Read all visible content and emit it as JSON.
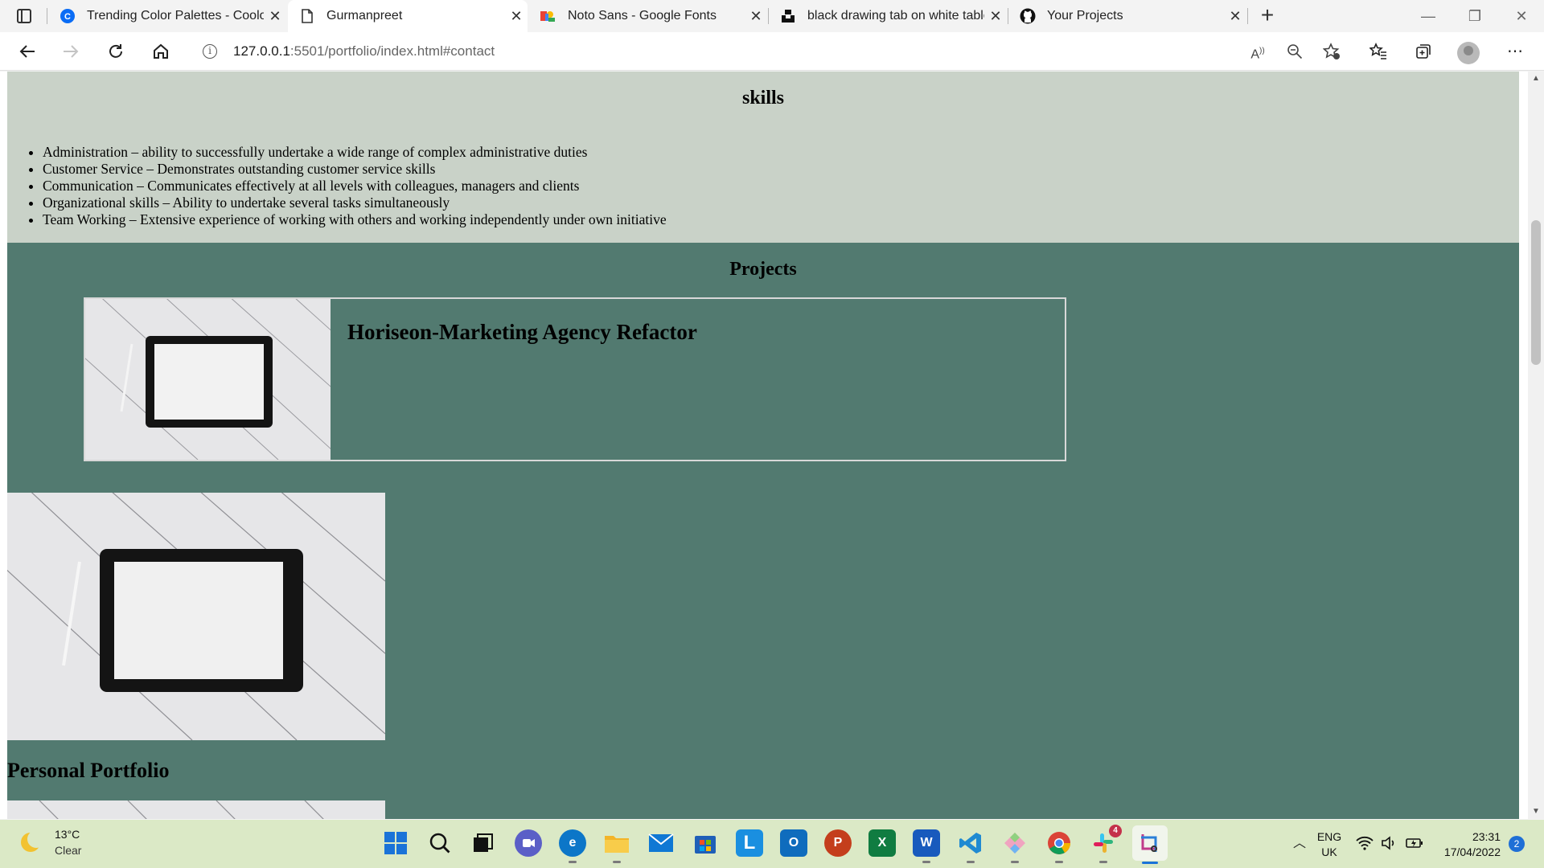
{
  "browser": {
    "tabs": [
      {
        "title": "Trending Color Palettes - Coolors",
        "icon": "coolors-icon",
        "active": false
      },
      {
        "title": "Gurmanpreet",
        "icon": "page-icon",
        "active": true
      },
      {
        "title": "Noto Sans - Google Fonts",
        "icon": "google-fonts-icon",
        "active": false
      },
      {
        "title": "black drawing tab on white table",
        "icon": "unsplash-icon",
        "active": false
      },
      {
        "title": "Your Projects",
        "icon": "github-icon",
        "active": false
      }
    ],
    "address": {
      "host": "127.0.0.1",
      "path": ":5501/portfolio/index.html#contact"
    }
  },
  "page": {
    "skills": {
      "heading": "skills",
      "items": [
        "Administration – ability to successfully undertake a wide range of complex administrative duties",
        "Customer Service – Demonstrates outstanding customer service skills",
        "Communication – Communicates effectively at all levels with colleagues, managers and clients",
        "Organizational skills – Ability to undertake several tasks simultaneously",
        "Team Working – Extensive experience of working with others and working independently under own initiative"
      ]
    },
    "projects": {
      "heading": "Projects",
      "card_title": "Horiseon-Marketing Agency Refactor",
      "second_title": "Personal Portfolio"
    }
  },
  "taskbar": {
    "weather": {
      "temp": "13°C",
      "condition": "Clear"
    },
    "slack_badge": "4",
    "lang_primary": "ENG",
    "lang_secondary": "UK",
    "time": "23:31",
    "date": "17/04/2022",
    "notifications": "2"
  },
  "colors": {
    "skills_bg": "#c9d2c8",
    "projects_bg": "#527a70",
    "taskbar_bg": "#dbe9c6"
  }
}
